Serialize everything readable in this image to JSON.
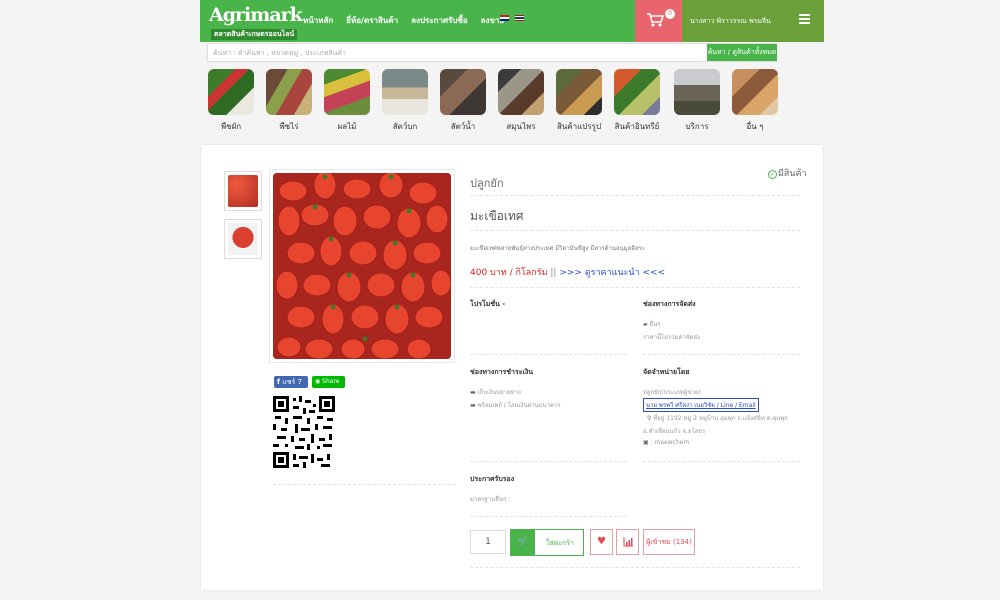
{
  "header": {
    "logo_text": "Agrimark",
    "logo_tagline": "ตลาดสินค้าเกษตรออนไลน์",
    "nav": [
      {
        "label": "หน้าหลัก"
      },
      {
        "label": "ยี่ห้อ/ตราสินค้า"
      },
      {
        "label": "ลงประกาศรับซื้อ"
      },
      {
        "label": "ลงขาย"
      }
    ],
    "cart_count": "0",
    "user_name": "นางสาว พิราวรรณ พรมจีน"
  },
  "search": {
    "placeholder": "ค้นหา : คำค้นหา , หมวดหมู่ , ประเภทสินค้า",
    "button_label": "ค้นหา / ดูสินค้าทั้งหมด"
  },
  "categories": [
    {
      "label": "พืชผัก"
    },
    {
      "label": "พืชไร่"
    },
    {
      "label": "ผลไม้"
    },
    {
      "label": "สัตว์บก"
    },
    {
      "label": "สัตว์น้ำ"
    },
    {
      "label": "สมุนไพร"
    },
    {
      "label": "สินค้าแปรรูป"
    },
    {
      "label": "สินค้าอินทรีย์"
    },
    {
      "label": "บริการ"
    },
    {
      "label": "อื่น ๆ"
    }
  ],
  "product": {
    "subcategory": "ปลูกยัก",
    "stock_status": "มีสินค้า",
    "title": "มะเขือเทศ",
    "description": "มะเขือเทศหลายพันธุ์ต่างประเทศ มีวิตามินซีสูง มีสารต้านอนุมูลอิสระ",
    "price": "400 บาท / กิโลกรัม",
    "price_separator": "||",
    "price_link": ">>> ดูราคาแนะนำ <<<"
  },
  "social": {
    "fb_label": "แชร์ 7",
    "line_label": "Share"
  },
  "info": {
    "promotion_title": "โปรโมชั่น -",
    "shipping_title": "ช่องทางการจัดส่ง",
    "shipping_method": "อื่นๆ",
    "shipping_note": "ราคานี้ไม่รวมค่าจัดส่ง",
    "payment_title": "ช่องทางการชำระเงิน",
    "payment_1": "เก็บเงินปลายทาง",
    "payment_2": "พร้อมเพย์ / โอนเงินผ่านธนาคาร",
    "seller_title": "จัดจำหน่ายโดย",
    "seller_type": "ปลูกยัก(ประเภทผู้ขาย)",
    "seller_name": "นาย พรพวี ศรีสง่า เนยวิชัย / Line / Email",
    "seller_address_1": "ที่อยู่ 1192 หมู่ 2 หมู่บ้าน ลุมพุก ถ.แจ้งสนิท ต.ลุมพุก",
    "seller_address_2": "อ.คำเขื่อนแก้ว จ.ยโสธร",
    "seller_contact": ": maewchem",
    "cert_title": "ประกาศรับรอง",
    "cert_text": "มาตรฐานอื่นๆ :"
  },
  "actions": {
    "quantity": "1",
    "add_to_cart": "ใส่ตะกร้า",
    "visitors": "ผู้เข้าชม (134)"
  }
}
